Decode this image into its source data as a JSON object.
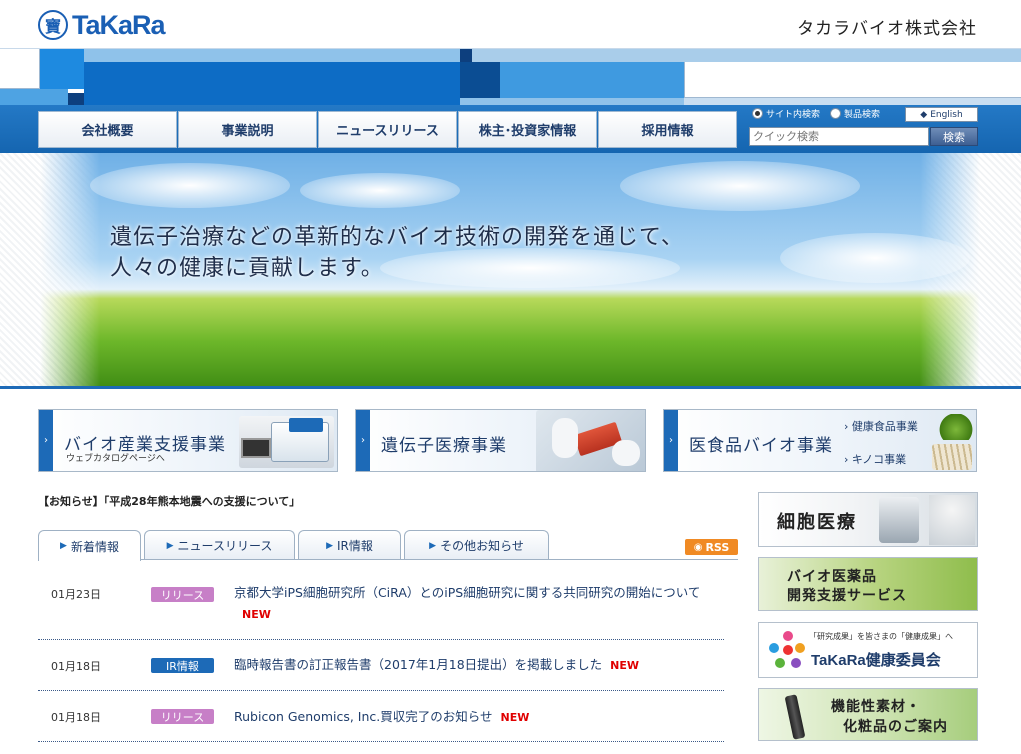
{
  "header": {
    "logo_text": "TaKaRa",
    "logo_mark": "寶",
    "company_name": "タカラバイオ株式会社"
  },
  "nav": {
    "items": [
      {
        "label": "会社概要"
      },
      {
        "label": "事業説明"
      },
      {
        "label": "ニュースリリース"
      },
      {
        "label": "株主･投資家情報"
      },
      {
        "label": "採用情報"
      }
    ]
  },
  "search": {
    "radio_site": "サイト内検索",
    "radio_product": "製品検索",
    "english_label": "English",
    "placeholder": "クイック検索",
    "button_label": "検索"
  },
  "hero": {
    "line1": "遺伝子治療などの革新的なバイオ技術の開発を通じて、",
    "line2": "人々の健康に貢献します。"
  },
  "business": [
    {
      "title": "バイオ産業支援事業",
      "sub": "ウェブカタログページへ"
    },
    {
      "title": "遺伝子医療事業"
    },
    {
      "title": "医食品バイオ事業",
      "links": [
        "健康食品事業",
        "キノコ事業"
      ]
    }
  ],
  "notice": "【お知らせ】「平成28年熊本地震への支援について」",
  "tabs": [
    {
      "label": "新着情報"
    },
    {
      "label": "ニュースリリース"
    },
    {
      "label": "IR情報"
    },
    {
      "label": "その他お知らせ"
    }
  ],
  "rss_label": "RSS",
  "news": [
    {
      "date": "01月23日",
      "badge": "リリース",
      "text": "京都大学iPS細胞研究所（CiRA）とのiPS細胞研究に関する共同研究の開始について",
      "new": "NEW"
    },
    {
      "date": "01月18日",
      "badge": "IR情報",
      "text": "臨時報告書の訂正報告書（2017年1月18日提出）を掲載しました",
      "new": "NEW"
    },
    {
      "date": "01月18日",
      "badge": "リリース",
      "text": "Rubicon Genomics, Inc.買収完了のお知らせ",
      "new": "NEW"
    }
  ],
  "right_banners": [
    {
      "title": "細胞医療"
    },
    {
      "line1": "バイオ医薬品",
      "line2": "開発支援サービス"
    },
    {
      "caption": "「研究成果」を皆さまの「健康成果」へ",
      "title": "TaKaRa健康委員会"
    },
    {
      "line1": "機能性素材・",
      "line2": "化粧品のご案内"
    }
  ],
  "colors": {
    "brand_blue": "#1d6ab7",
    "release_badge": "#c77fc7",
    "ir_badge": "#1d6ab7",
    "new_red": "#e00000",
    "rss_orange": "#f08a24"
  }
}
